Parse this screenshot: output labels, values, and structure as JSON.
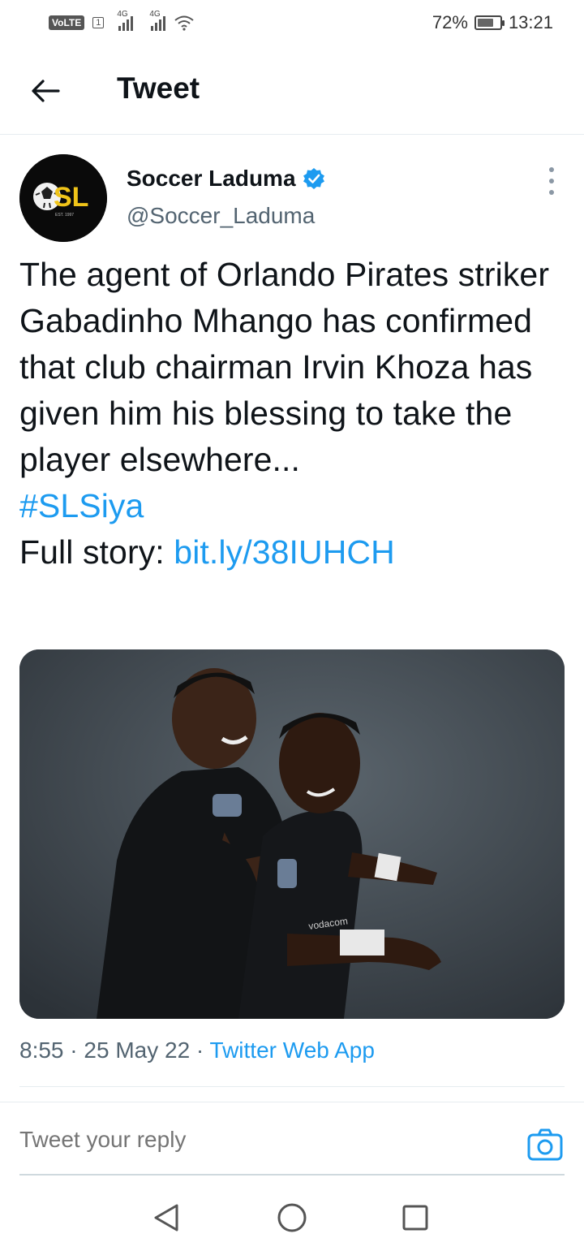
{
  "status_bar": {
    "volte": "VoLTE",
    "sim1": "1",
    "net1": "4G",
    "net2": "4G",
    "battery_percent": "72%",
    "battery_level": 0.72,
    "time": "13:21"
  },
  "header": {
    "title": "Tweet",
    "back_icon": "arrow-left-icon"
  },
  "tweet": {
    "author": {
      "name": "Soccer Laduma",
      "handle": "@Soccer_Laduma",
      "verified": true,
      "avatar_text": "SL",
      "avatar_subtext": "EST. 1997"
    },
    "text": "The agent of Orlando Pirates striker Gabadinho Mhango has confirmed that club chairman Irvin Khoza has given him his blessing to take the player elsewhere...",
    "hashtag": "#SLSiya",
    "link_prefix": "Full story: ",
    "link": "bit.ly/38IUHCH",
    "media_alt": "Two Orlando Pirates players in black kit celebrating",
    "meta": {
      "time": "8:55",
      "sep": " · ",
      "date": "25 May 22",
      "app": "Twitter Web App"
    }
  },
  "reply": {
    "placeholder": "Tweet your reply",
    "camera_icon": "camera-icon"
  },
  "colors": {
    "accent": "#1d9bf0",
    "text": "#0f1419",
    "muted": "#536471"
  }
}
